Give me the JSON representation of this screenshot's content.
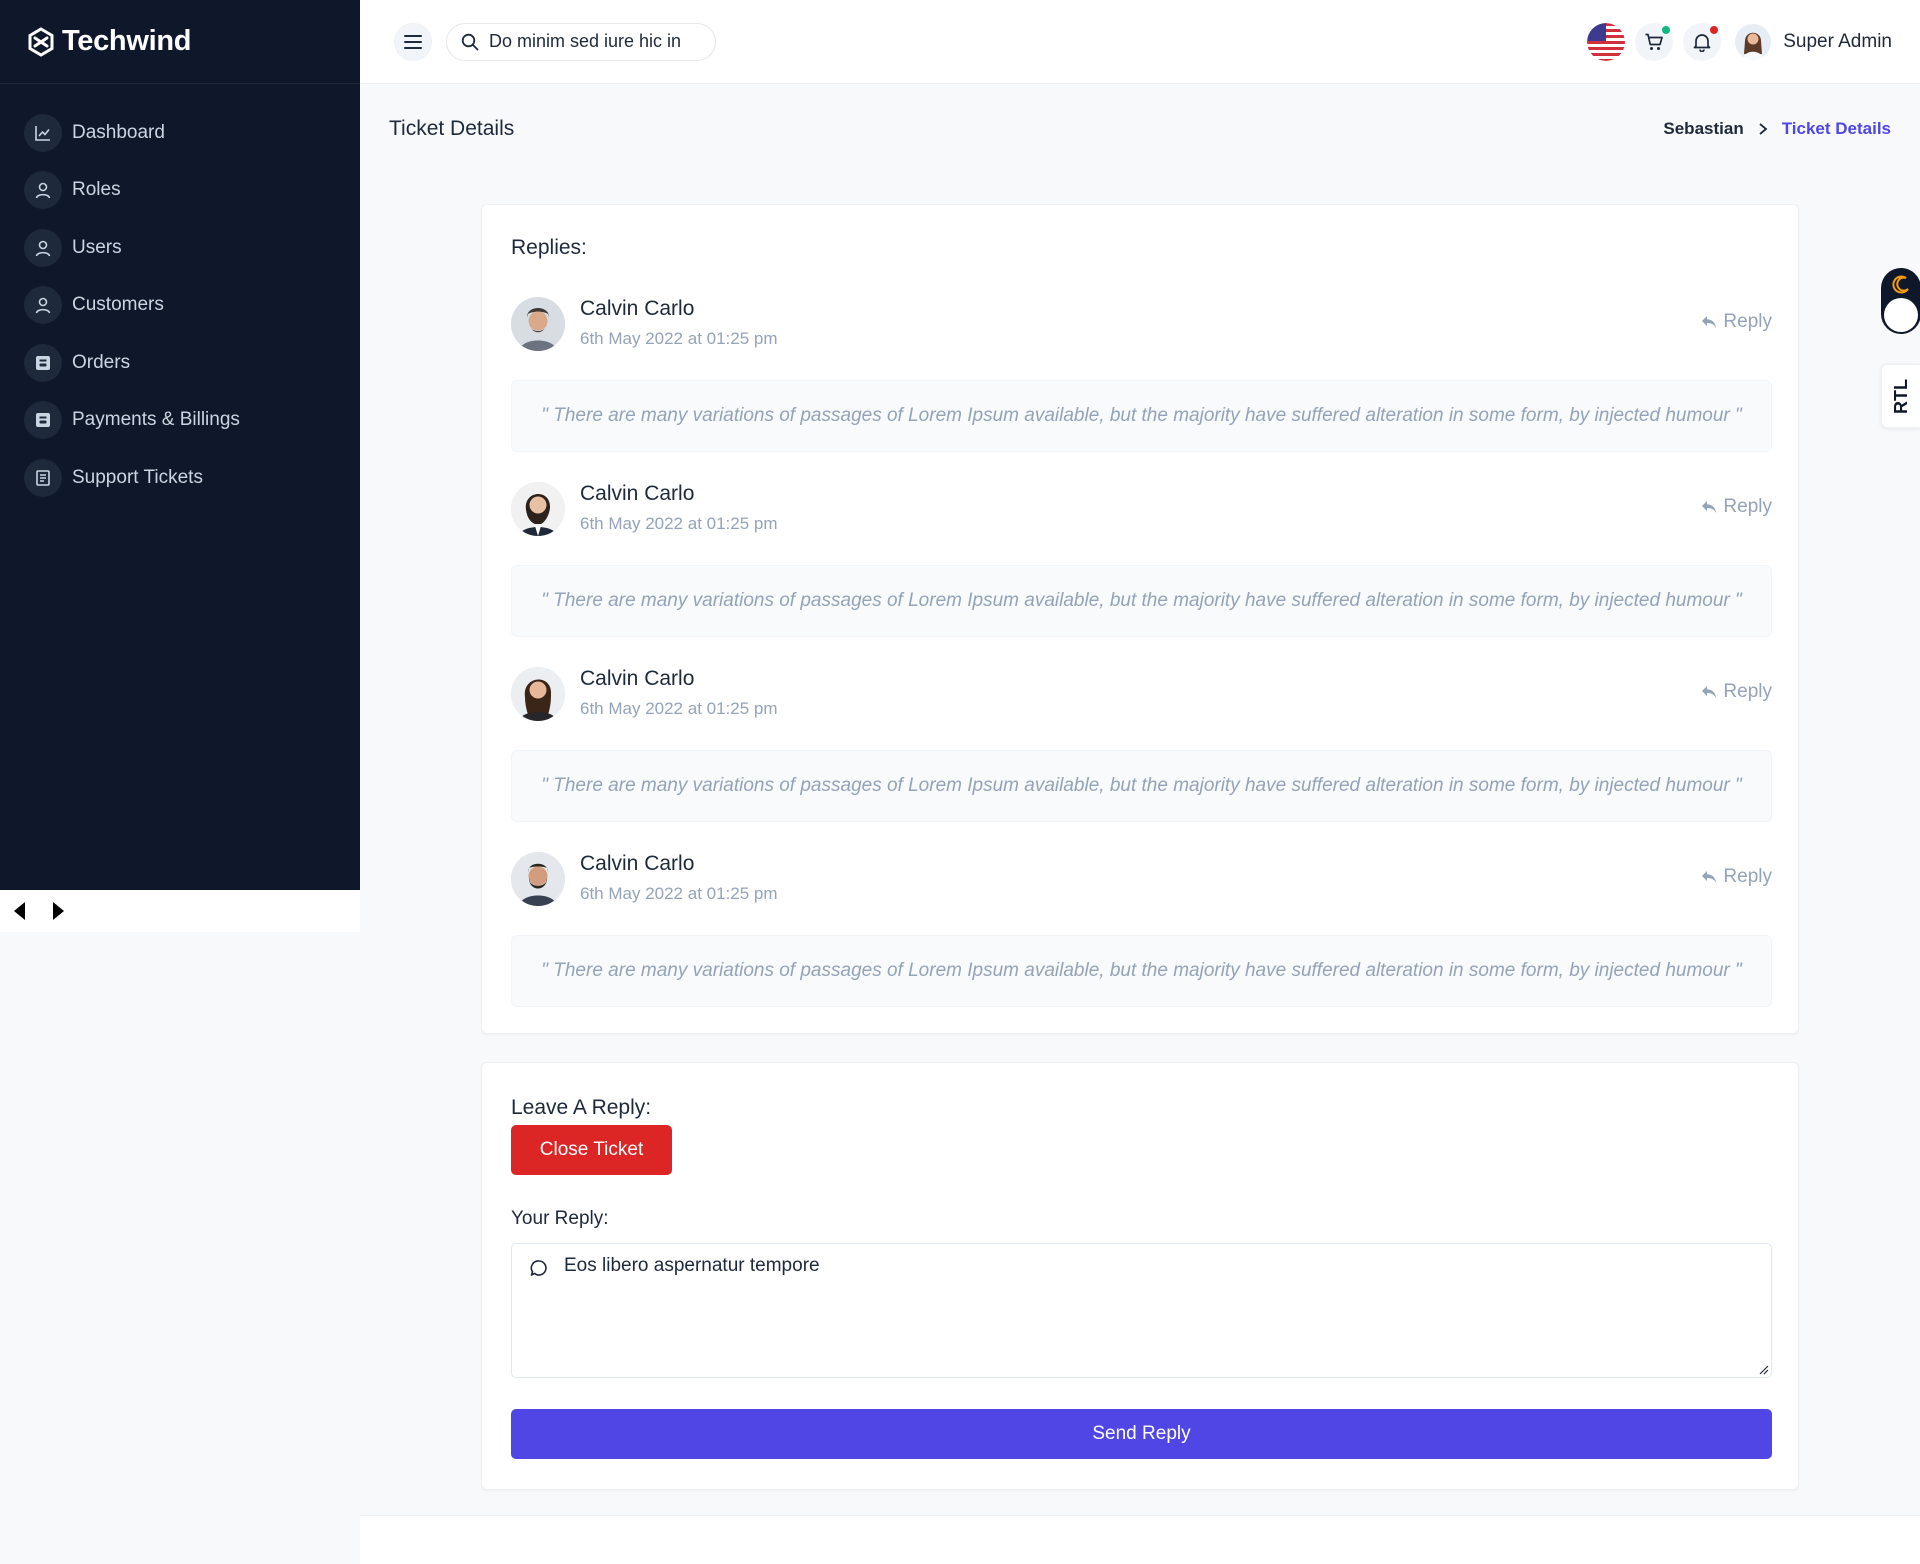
{
  "brand": {
    "name": "Techwind"
  },
  "sidebar": {
    "items": [
      {
        "label": "Dashboard",
        "icon": "chart-icon"
      },
      {
        "label": "Roles",
        "icon": "user-icon"
      },
      {
        "label": "Users",
        "icon": "user-icon"
      },
      {
        "label": "Customers",
        "icon": "user-icon"
      },
      {
        "label": "Orders",
        "icon": "box-icon"
      },
      {
        "label": "Payments & Billings",
        "icon": "box-icon"
      },
      {
        "label": "Support Tickets",
        "icon": "ticket-icon"
      }
    ]
  },
  "topbar": {
    "search_value": "Do minim sed iure hic in",
    "user_name": "Super Admin",
    "cart_dot_color": "#10b981",
    "notification_dot_color": "#dc2626"
  },
  "page": {
    "title": "Ticket Details",
    "breadcrumb": {
      "home": "Sebastian",
      "current": "Ticket Details"
    }
  },
  "replies": {
    "heading": "Replies:",
    "reply_label": "Reply",
    "items": [
      {
        "author": "Calvin Carlo",
        "date": "6th May 2022 at 01:25 pm",
        "text": "\" There are many variations of passages of Lorem Ipsum available, but the majority have suffered alteration in some form, by injected humour \""
      },
      {
        "author": "Calvin Carlo",
        "date": "6th May 2022 at 01:25 pm",
        "text": "\" There are many variations of passages of Lorem Ipsum available, but the majority have suffered alteration in some form, by injected humour \""
      },
      {
        "author": "Calvin Carlo",
        "date": "6th May 2022 at 01:25 pm",
        "text": "\" There are many variations of passages of Lorem Ipsum available, but the majority have suffered alteration in some form, by injected humour \""
      },
      {
        "author": "Calvin Carlo",
        "date": "6th May 2022 at 01:25 pm",
        "text": "\" There are many variations of passages of Lorem Ipsum available, but the majority have suffered alteration in some form, by injected humour \""
      }
    ]
  },
  "reply_form": {
    "heading": "Leave A Reply:",
    "close_label": "Close Ticket",
    "field_label": "Your Reply:",
    "field_value": "Eos libero aspernatur tempore",
    "send_label": "Send Reply"
  },
  "widgets": {
    "rtl_label": "RTL"
  },
  "colors": {
    "sidebar_bg": "#0f172a",
    "accent": "#4f46e5",
    "danger": "#dc2626"
  }
}
